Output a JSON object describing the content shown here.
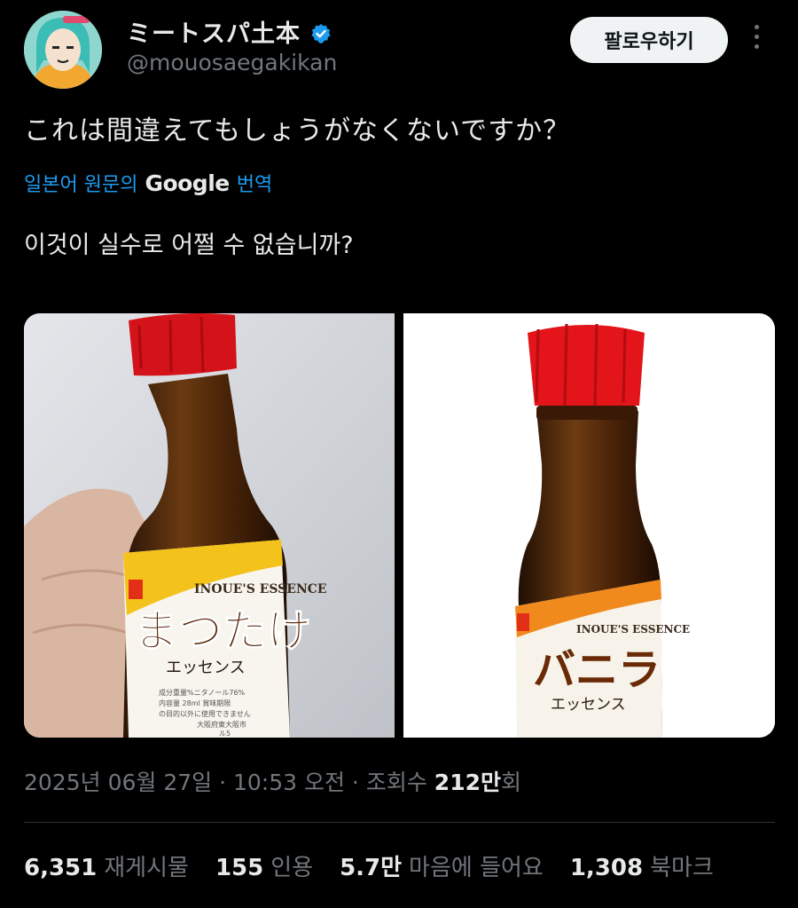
{
  "user": {
    "name": "ミートスパ土本",
    "handle": "@mouosaegakikan",
    "follow_label": "팔로우하기"
  },
  "tweet": {
    "text": "これは間違えてもしょうがなくないですか？",
    "translate_prefix": "일본어 원문의",
    "translate_brand": "Google",
    "translate_suffix": "번역",
    "translated": "이것이 실수로 어쩔 수 없습니까?"
  },
  "images": {
    "left": {
      "brand": "INOUE'S ESSENCE",
      "title": "まつたけ",
      "subtitle": "エッセンス",
      "fine1": "成分重量%ニタノール76%",
      "fine2": "内容量 28ml 賞味期限",
      "fine3": "の目的以外に使用できません",
      "fine4": "大阪府東大阪市",
      "fine5": "ル5"
    },
    "right": {
      "brand": "INOUE'S ESSENCE",
      "title": "バニラ",
      "subtitle": "エッセンス"
    }
  },
  "meta": {
    "date": "2025년 06월 27일",
    "time": "10:53 오전",
    "views_label": "조회수",
    "views_count": "212만",
    "views_suffix": "회"
  },
  "stats": [
    {
      "count": "6,351",
      "label": "재게시물"
    },
    {
      "count": "155",
      "label": "인용"
    },
    {
      "count": "5.7만",
      "label": "마음에 들어요"
    },
    {
      "count": "1,308",
      "label": "북마크"
    }
  ],
  "colors": {
    "background": "#000000",
    "link": "#1d9bf0",
    "verified": "#1d9bf0",
    "muted": "#71767b"
  }
}
